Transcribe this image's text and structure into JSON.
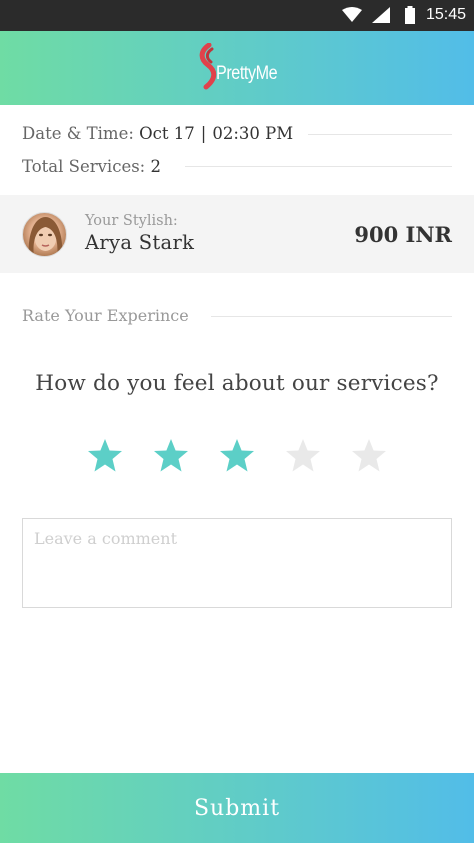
{
  "status_bar": {
    "time": "15:45",
    "icons": [
      "wifi-icon",
      "signal-icon",
      "battery-icon"
    ]
  },
  "header": {
    "logo_text": "PrettyMe",
    "colors": {
      "gradient_start": "#6fdca4",
      "gradient_end": "#52bde8",
      "logo_accent": "#e0424b"
    }
  },
  "booking": {
    "datetime_label": "Date & Time:",
    "date": "Oct 17",
    "separator": "|",
    "time": "02:30 PM",
    "services_label": "Total Services:",
    "services_count": "2"
  },
  "stylist": {
    "caption": "Your Stylish:",
    "name": "Arya Stark",
    "price": "900 INR"
  },
  "rating": {
    "section_label": "Rate Your Experince",
    "question": "How do you feel about our services?",
    "value": 3,
    "max": 5,
    "colors": {
      "filled": "#5ccfc7",
      "empty": "#e9e9e9"
    }
  },
  "comment": {
    "placeholder": "Leave a comment",
    "value": ""
  },
  "submit": {
    "label": "Submit"
  }
}
